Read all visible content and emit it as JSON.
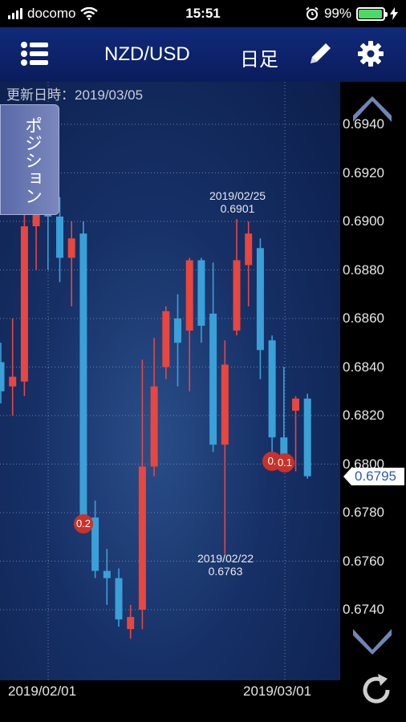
{
  "status_bar": {
    "carrier": "docomo",
    "time": "15:51",
    "battery": "99%"
  },
  "nav": {
    "pair": "NZD/USD",
    "timeframe": "日足"
  },
  "updated_label": "更新日時：2019/03/05",
  "position_tab": "ポジション",
  "current_price": "0.6795",
  "y_axis_labels": [
    "0.6940",
    "0.6920",
    "0.6900",
    "0.6880",
    "0.6860",
    "0.6840",
    "0.6820",
    "0.6800",
    "0.6780",
    "0.6760",
    "0.6740"
  ],
  "x_axis_labels": [
    "2019/02/01",
    "2019/03/01"
  ],
  "annotations": {
    "high_date": "2019/02/25",
    "high_value": "0.6901",
    "low_date": "2019/02/22",
    "low_value": "0.6763"
  },
  "badges": [
    "0.2",
    "0.",
    "0.1"
  ],
  "colors": {
    "up": "#e8463f",
    "down": "#3aa0d8",
    "nav_bg": "#0f267a"
  },
  "chart_data": {
    "type": "candlestick",
    "x_labels": [
      "2019/02/01",
      "2019/03/01"
    ],
    "ylim": [
      0.6728,
      0.695
    ],
    "candles": [
      {
        "o": 0.683,
        "h": 0.685,
        "l": 0.6825,
        "c": 0.6842,
        "dir": "down"
      },
      {
        "o": 0.6832,
        "h": 0.686,
        "l": 0.682,
        "c": 0.6836,
        "dir": "up"
      },
      {
        "o": 0.6834,
        "h": 0.6905,
        "l": 0.6828,
        "c": 0.6898,
        "dir": "up"
      },
      {
        "o": 0.6898,
        "h": 0.6935,
        "l": 0.688,
        "c": 0.692,
        "dir": "up"
      },
      {
        "o": 0.6916,
        "h": 0.6935,
        "l": 0.688,
        "c": 0.6902,
        "dir": "down"
      },
      {
        "o": 0.6902,
        "h": 0.691,
        "l": 0.6875,
        "c": 0.6885,
        "dir": "down"
      },
      {
        "o": 0.6885,
        "h": 0.69,
        "l": 0.6865,
        "c": 0.6893,
        "dir": "up"
      },
      {
        "o": 0.6895,
        "h": 0.69,
        "l": 0.6775,
        "c": 0.6778,
        "dir": "down"
      },
      {
        "o": 0.6778,
        "h": 0.6785,
        "l": 0.6753,
        "c": 0.6756,
        "dir": "down"
      },
      {
        "o": 0.6756,
        "h": 0.6765,
        "l": 0.6742,
        "c": 0.6753,
        "dir": "down"
      },
      {
        "o": 0.6753,
        "h": 0.6757,
        "l": 0.6733,
        "c": 0.6736,
        "dir": "down"
      },
      {
        "o": 0.6732,
        "h": 0.6742,
        "l": 0.6728,
        "c": 0.6737,
        "dir": "up"
      },
      {
        "o": 0.674,
        "h": 0.6843,
        "l": 0.6732,
        "c": 0.6799,
        "dir": "up"
      },
      {
        "o": 0.6799,
        "h": 0.6852,
        "l": 0.6795,
        "c": 0.6832,
        "dir": "up"
      },
      {
        "o": 0.684,
        "h": 0.6865,
        "l": 0.6835,
        "c": 0.6863,
        "dir": "up"
      },
      {
        "o": 0.686,
        "h": 0.687,
        "l": 0.6832,
        "c": 0.685,
        "dir": "down"
      },
      {
        "o": 0.6855,
        "h": 0.6885,
        "l": 0.683,
        "c": 0.6884,
        "dir": "up"
      },
      {
        "o": 0.6884,
        "h": 0.6885,
        "l": 0.685,
        "c": 0.6857,
        "dir": "down"
      },
      {
        "o": 0.6862,
        "h": 0.6883,
        "l": 0.6805,
        "c": 0.6808,
        "dir": "down"
      },
      {
        "o": 0.6808,
        "h": 0.6851,
        "l": 0.6763,
        "c": 0.6841,
        "dir": "up"
      },
      {
        "o": 0.6855,
        "h": 0.6901,
        "l": 0.6853,
        "c": 0.6884,
        "dir": "up"
      },
      {
        "o": 0.6882,
        "h": 0.69,
        "l": 0.6865,
        "c": 0.6895,
        "dir": "up"
      },
      {
        "o": 0.6889,
        "h": 0.6893,
        "l": 0.6835,
        "c": 0.6847,
        "dir": "down"
      },
      {
        "o": 0.6851,
        "h": 0.6853,
        "l": 0.6798,
        "c": 0.6811,
        "dir": "down"
      },
      {
        "o": 0.6811,
        "h": 0.684,
        "l": 0.68,
        "c": 0.6804,
        "dir": "down"
      },
      {
        "o": 0.6822,
        "h": 0.6828,
        "l": 0.6797,
        "c": 0.6827,
        "dir": "up"
      },
      {
        "o": 0.6827,
        "h": 0.6829,
        "l": 0.6794,
        "c": 0.6795,
        "dir": "down"
      }
    ]
  }
}
